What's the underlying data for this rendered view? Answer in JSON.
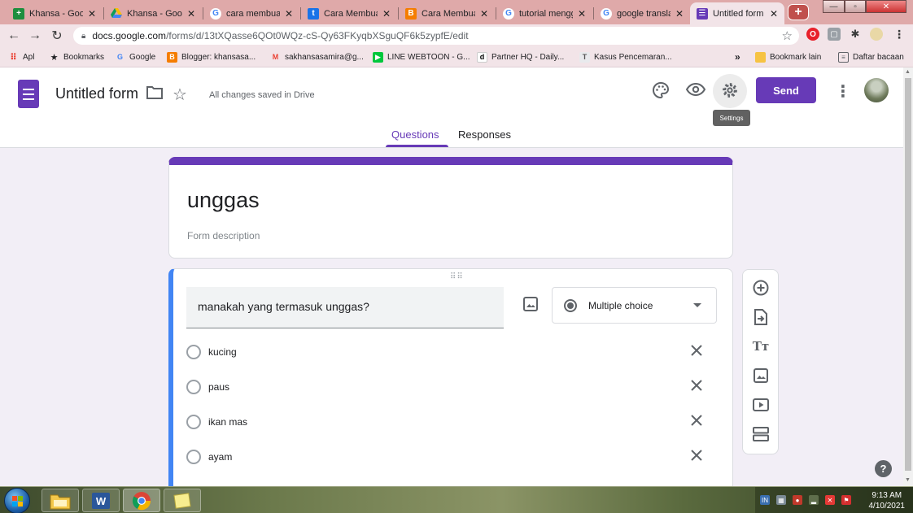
{
  "browser": {
    "tabs": [
      {
        "label": "Khansa - Goog",
        "icon": "google-sheets-icon"
      },
      {
        "label": "Khansa - Goog",
        "icon": "google-drive-icon"
      },
      {
        "label": "cara membuat",
        "icon": "google-icon"
      },
      {
        "label": "Cara Membuat",
        "icon": "site-icon"
      },
      {
        "label": "Cara Membuat",
        "icon": "blogger-icon"
      },
      {
        "label": "tutorial mengg",
        "icon": "google-icon"
      },
      {
        "label": "google translat",
        "icon": "google-icon"
      },
      {
        "label": "Untitled form -",
        "icon": "google-forms-icon"
      }
    ],
    "new_tab_label": "+",
    "url_host": "docs.google.com",
    "url_path": "/forms/d/13tXQasse6QOt0WQz-cS-Qy63FKyqbXSguQF6k5zypfE/edit",
    "bookmarks": [
      {
        "label": "Apl"
      },
      {
        "label": "Bookmarks"
      },
      {
        "label": "Google"
      },
      {
        "label": "Blogger: khansasa..."
      },
      {
        "label": "sakhansasamira@g..."
      },
      {
        "label": "LINE WEBTOON - G..."
      },
      {
        "label": "Partner HQ - Daily..."
      },
      {
        "label": "Kasus Pencemaran..."
      }
    ],
    "bookmarks_more": "»",
    "bookmark_other": "Bookmark lain",
    "reading_list": "Daftar bacaan"
  },
  "forms": {
    "doc_title": "Untitled form",
    "save_status": "All changes saved in Drive",
    "send_label": "Send",
    "settings_tooltip": "Settings",
    "tabs": [
      {
        "label": "Questions",
        "selected": true
      },
      {
        "label": "Responses",
        "selected": false
      }
    ],
    "accent_color": "#673ab7",
    "form_title": "unggas",
    "form_description_placeholder": "Form description",
    "question": {
      "text": "manakah yang termasuk unggas?",
      "type_label": "Multiple choice",
      "options": [
        {
          "label": "kucing"
        },
        {
          "label": "paus"
        },
        {
          "label": "ikan mas"
        },
        {
          "label": "ayam"
        }
      ]
    },
    "help_label": "?"
  },
  "taskbar": {
    "time": "9:13 AM",
    "date": "4/10/2021"
  }
}
